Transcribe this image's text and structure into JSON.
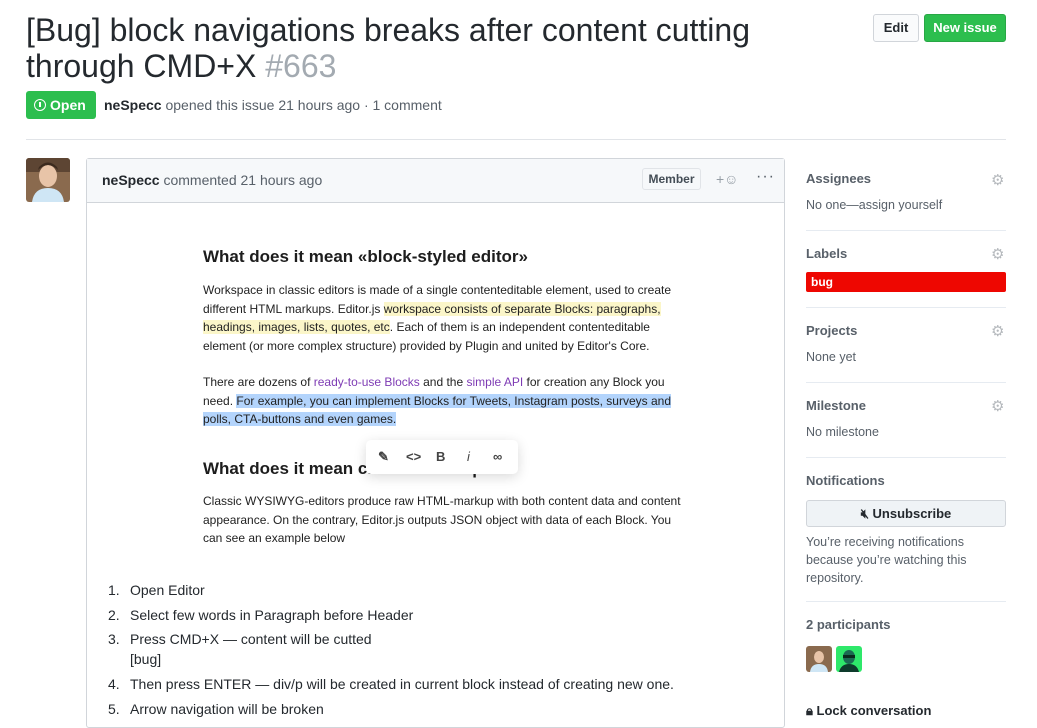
{
  "issue": {
    "title": "[Bug] block navigations breaks after content cutting through CMD+X",
    "number": "#663",
    "state": "Open",
    "author": "neSpecc",
    "meta_text": "opened this issue 21 hours ago · 1 comment"
  },
  "header_buttons": {
    "edit": "Edit",
    "new_issue": "New issue"
  },
  "comment": {
    "author": "neSpecc",
    "time": "commented 21 hours ago",
    "badge": "Member",
    "reaction_icon": "smiley-plus-icon",
    "more": "···",
    "screenshot": {
      "h1": "What does it mean «block-styled editor»",
      "p1_a": "Workspace in classic editors is made of a single contenteditable element, used to create different HTML markups. Editor.js ",
      "p1_hl": "workspace consists of separate Blocks: paragraphs, headings, images, lists, quotes, etc",
      "p1_b": ". Each of them is an independent contenteditable element (or more complex structure) provided by Plugin and united by Editor's Core.",
      "p2_a": "There are dozens of ",
      "p2_link1": "ready-to-use Blocks",
      "p2_b": " and the ",
      "p2_link2": "simple API",
      "p2_c": " for creation any Block you need. ",
      "p2_sel": "For example, you can implement Blocks for Tweets, Instagram posts, surveys and polls, CTA-buttons and even games.",
      "h2": "What does it mean clean data output",
      "p3": "Classic WYSIWYG-editors produce raw HTML-markup with both content data and content appearance. On the contrary, Editor.js outputs JSON object with data of each Block. You can see an example below",
      "toolbar": [
        "marker-icon",
        "code-icon",
        "bold-icon",
        "italic-icon",
        "link-icon"
      ]
    },
    "steps": [
      {
        "n": "1.",
        "text": "Open Editor"
      },
      {
        "n": "2.",
        "text": "Select few words in Paragraph before Header"
      },
      {
        "n": "3.",
        "text": "Press CMD+X — content will be cutted",
        "sub": "[bug]"
      },
      {
        "n": "4.",
        "text": "Then press ENTER — div/p will be created in current block instead of creating new one."
      },
      {
        "n": "5.",
        "text": "Arrow navigation will be broken"
      }
    ]
  },
  "sidebar": {
    "assignees": {
      "label": "Assignees",
      "value": "No one—assign yourself"
    },
    "labels": {
      "label": "Labels",
      "tag": "bug",
      "tag_color": "#ee0701"
    },
    "projects": {
      "label": "Projects",
      "value": "None yet"
    },
    "milestone": {
      "label": "Milestone",
      "value": "No milestone"
    },
    "notifications": {
      "label": "Notifications",
      "button": "Unsubscribe",
      "text": "You’re receiving notifications because you’re watching this repository."
    },
    "participants": {
      "label": "2 participants"
    },
    "lock": "Lock conversation"
  },
  "colors": {
    "open_green": "#2cbe4e",
    "link_purple": "#7e3bb4",
    "selection_blue": "#b3d4fc"
  }
}
